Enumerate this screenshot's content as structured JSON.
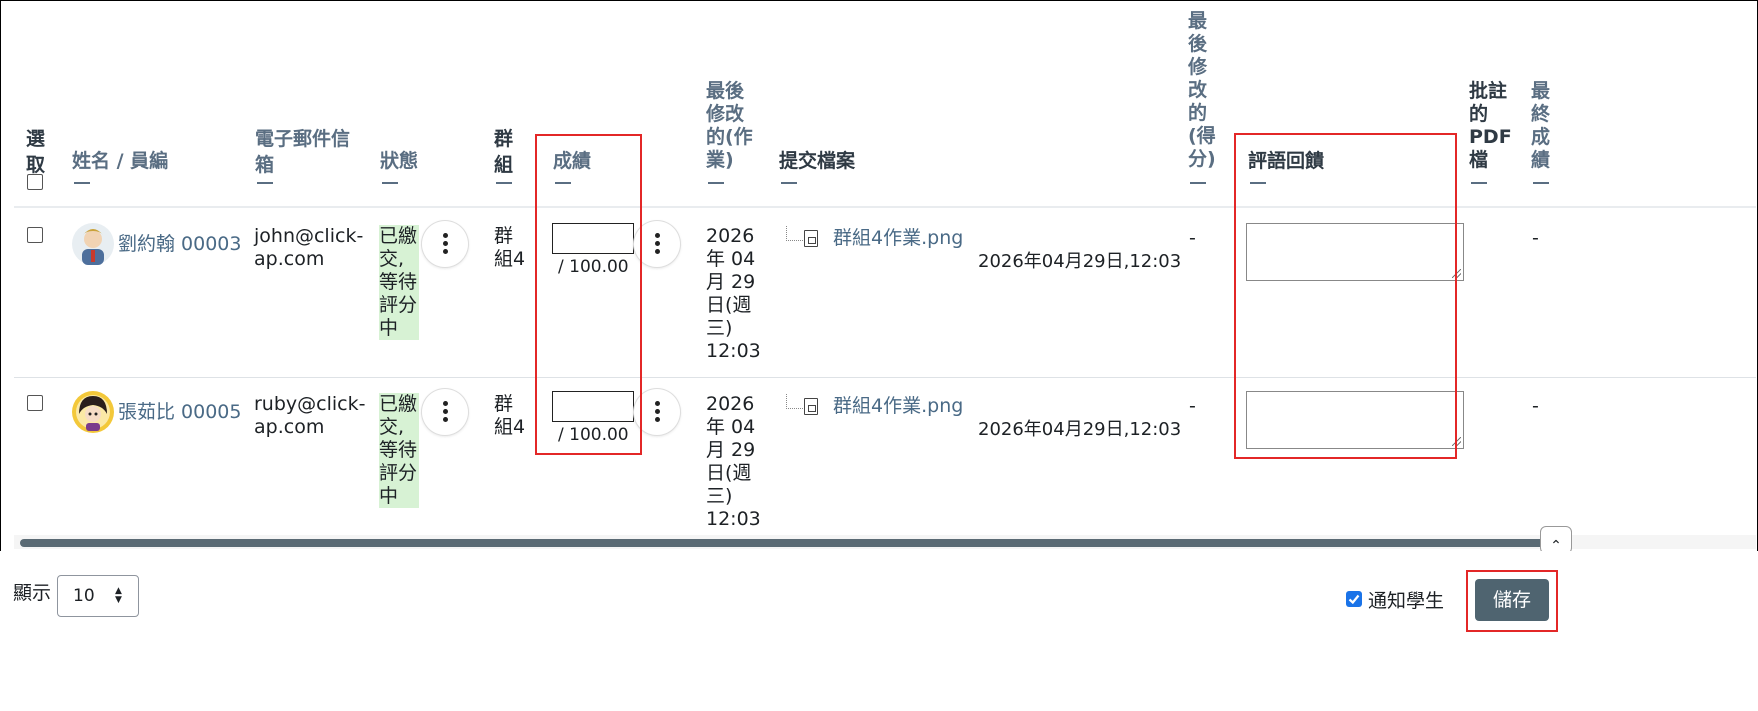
{
  "headers": {
    "select": "選\n取",
    "name": "姓名 / 員編",
    "email": "電子郵件信\n箱",
    "status": "狀態",
    "group": "群\n組",
    "grade": "成績",
    "last_modified_submission": "最後\n修改\n的(作\n業)",
    "files": "提交檔案",
    "last_modified_grade": "最\n後\n修\n改\n的\n(得\n分)",
    "feedback": "評語回饋",
    "annotated_pdf": "批註\n的\nPDF\n檔",
    "final_grade": "最\n終\n成\n績"
  },
  "rows": [
    {
      "name": "劉約翰 00003",
      "email": "john@click-\nap.com",
      "status": "已繳\n交,\n等待\n評分\n中",
      "group": "群\n組4",
      "grade_value": "",
      "grade_max": "/ 100.00",
      "modified": "2026\n年 04\n月 29\n日(週\n三)\n12:03",
      "file": "群組4作業.png",
      "file_time": "2026年04月29日,12:03",
      "last_modified_grade": "-",
      "feedback": "",
      "final_grade": "-"
    },
    {
      "name": "張茹比 00005",
      "email": "ruby@click-\nap.com",
      "status": "已繳\n交,\n等待\n評分\n中",
      "group": "群\n組4",
      "grade_value": "",
      "grade_max": "/ 100.00",
      "modified": "2026\n年 04\n月 29\n日(週\n三)\n12:03",
      "file": "群組4作業.png",
      "file_time": "2026年04月29日,12:03",
      "last_modified_grade": "-",
      "feedback": "",
      "final_grade": "-"
    }
  ],
  "footer": {
    "show_label": "顯示",
    "per_page": "10",
    "notify_label": "通知學生",
    "notify_checked": true,
    "save_label": "儲存"
  },
  "colors": {
    "highlight": "#e32727",
    "status_bg": "#d7f2d4",
    "save_button": "#4f6470",
    "link": "#4a6a86"
  }
}
